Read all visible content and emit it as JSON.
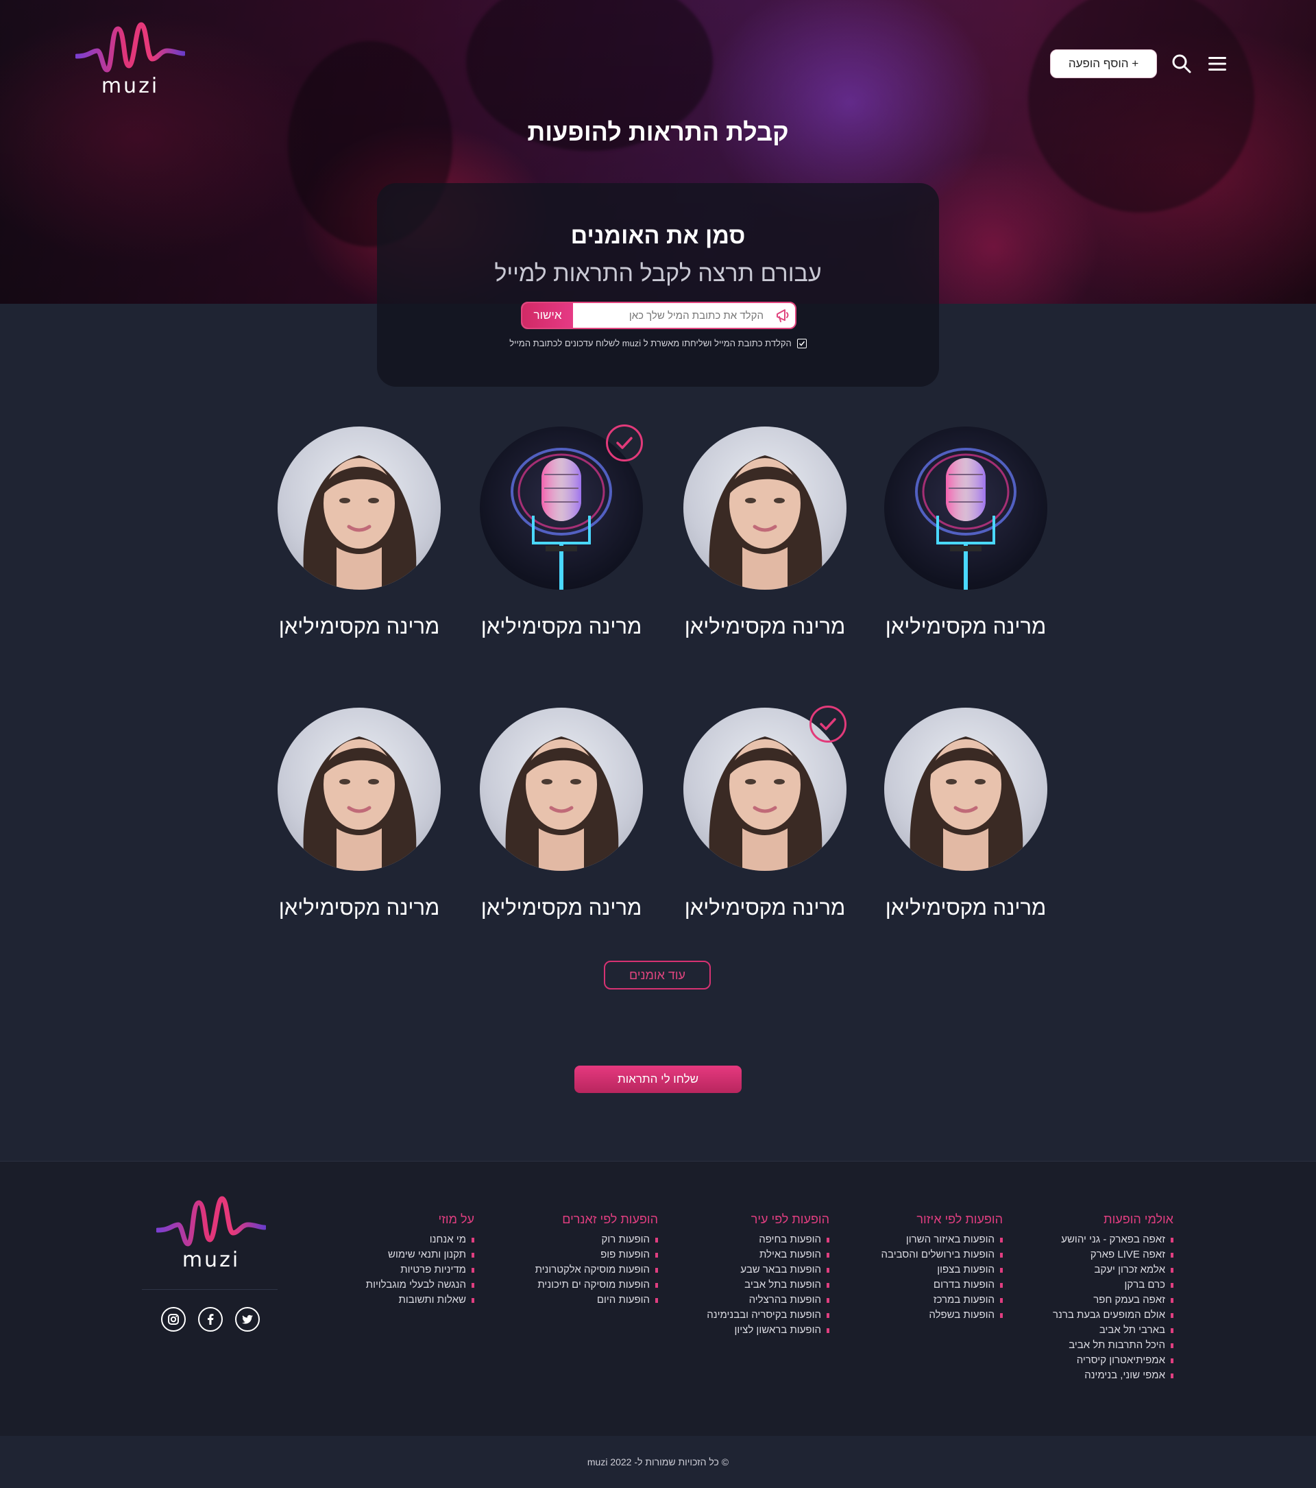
{
  "brand": {
    "name": "muzi",
    "accent": "#e0457e",
    "accent_dark": "#b8265e",
    "background": "#1f2433"
  },
  "header": {
    "add_show_label": "+ הוסף הופעה",
    "search_icon": "search-icon",
    "menu_icon": "menu-icon"
  },
  "page": {
    "title": "קבלת התראות להופעות"
  },
  "signup": {
    "title": "סמן את האומנים",
    "subtitle": "עבורם תרצה לקבל התראות למייל",
    "email_placeholder": "הקלד את כתובת המיל שלך כאן",
    "confirm_label": "אישור",
    "consent_text": "הקלדת כתובת המייל ושליחתו מאשרת ל muzi לשלוח עדכונים לכתובת המייל",
    "consent_checked": true
  },
  "artists": [
    {
      "name": "מרינה מקסימיליאן",
      "image": "microphone",
      "selected": false
    },
    {
      "name": "מרינה מקסימיליאן",
      "image": "woman",
      "selected": false
    },
    {
      "name": "מרינה מקסימיליאן",
      "image": "microphone",
      "selected": true
    },
    {
      "name": "מרינה מקסימיליאן",
      "image": "woman",
      "selected": false
    },
    {
      "name": "מרינה מקסימיליאן",
      "image": "woman",
      "selected": false
    },
    {
      "name": "מרינה מקסימיליאן",
      "image": "woman",
      "selected": true
    },
    {
      "name": "מרינה מקסימיליאן",
      "image": "woman",
      "selected": false
    },
    {
      "name": "מרינה מקסימיליאן",
      "image": "woman",
      "selected": false
    }
  ],
  "more_artists_label": "עוד אומנים",
  "send_label": "שלחו לי התראות",
  "footer": {
    "columns": [
      {
        "title": "אולמי הופעות",
        "items": [
          "זאפה בפארק - גני יהושע",
          "זאפה LIVE פארק",
          "אלמא זכרון יעקב",
          "כרם ברקן",
          "זאפה בעמק חפר",
          "אולם המופעים גבעת ברנר",
          "בארבי תל אביב",
          "היכל התרבות תל אביב",
          "אמפיתיאטרון קיסריה",
          "אמפי שוני, בנימינה"
        ]
      },
      {
        "title": "הופעות לפי איזור",
        "items": [
          "הופעות באיזור השרון",
          "הופעות בירושלים והסביבה",
          "הופעות בצפון",
          "הופעות בדרום",
          "הופעות במרכז",
          "הופעות בשפלה"
        ]
      },
      {
        "title": "הופעות לפי עיר",
        "items": [
          "הופעות בחיפה",
          "הופעות באילת",
          "הופעות בבאר שבע",
          "הופעות בתל אביב",
          "הופעות בהרצליה",
          "הופעות בקיסריה ובבנימינה",
          "הופעות בראשון לציון"
        ]
      },
      {
        "title": "הופעות לפי זאנרים",
        "items": [
          "הופעות רוק",
          "הופעות פופ",
          "הופעות מוסיקה אלקטרונית",
          "הופעות מוסיקה ים תיכונית",
          "הופעות היום"
        ]
      },
      {
        "title": "על מוזי",
        "items": [
          "מי אנחנו",
          "תקנון ותנאי שימוש",
          "מדיניות פרטיות",
          "הנגשה לבעלי מוגבלויות",
          "שאלות ותשובות"
        ]
      }
    ],
    "social": [
      "instagram-icon",
      "facebook-icon",
      "twitter-icon"
    ],
    "copyright": "© כל הזכויות שמורות ל- muzi 2022"
  }
}
